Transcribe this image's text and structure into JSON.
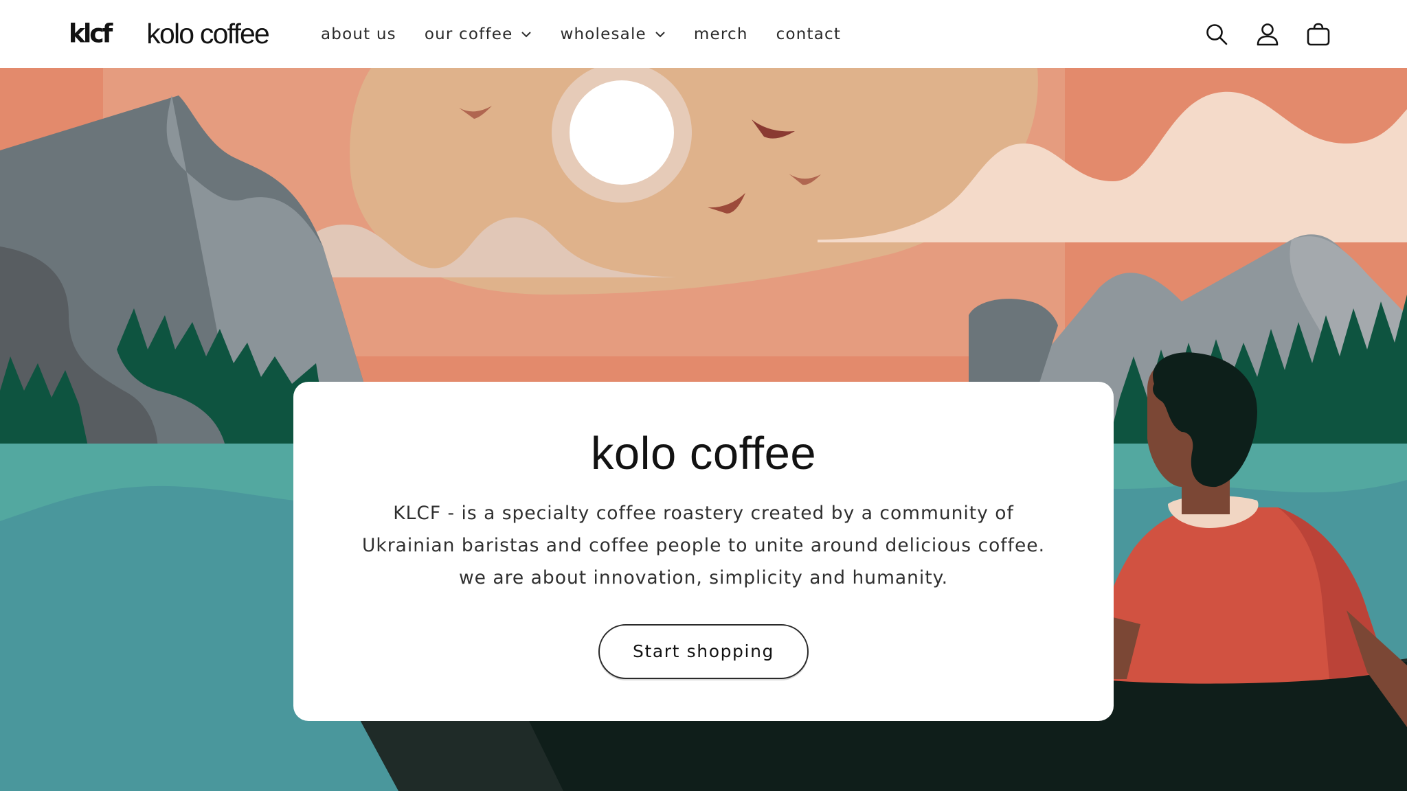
{
  "header": {
    "brand_mark": "klcf",
    "brand_name": "kolo coffee",
    "nav": [
      {
        "label": "about us",
        "has_dropdown": false
      },
      {
        "label": "our coffee",
        "has_dropdown": true
      },
      {
        "label": "wholesale",
        "has_dropdown": true
      },
      {
        "label": "merch",
        "has_dropdown": false
      },
      {
        "label": "contact",
        "has_dropdown": false
      }
    ],
    "icons": [
      "search-icon",
      "account-icon",
      "cart-icon"
    ]
  },
  "hero": {
    "title": "kolo coffee",
    "description": "KLCF - is a specialty coffee roastery created by a community of Ukrainian baristas and coffee people to unite around delicious coffee. we are about innovation, simplicity and humanity.",
    "cta_label": "Start shopping"
  },
  "colors": {
    "sky": "#e38a6c",
    "sun_glow": "#dfb28b",
    "cloud": "#f4dac9",
    "mountain": "#6b757a",
    "forest": "#0e5440",
    "lake": "#4a979c",
    "boat": "#112019",
    "shirt": "#d15241",
    "card": "#ffffff",
    "text": "#121212"
  }
}
